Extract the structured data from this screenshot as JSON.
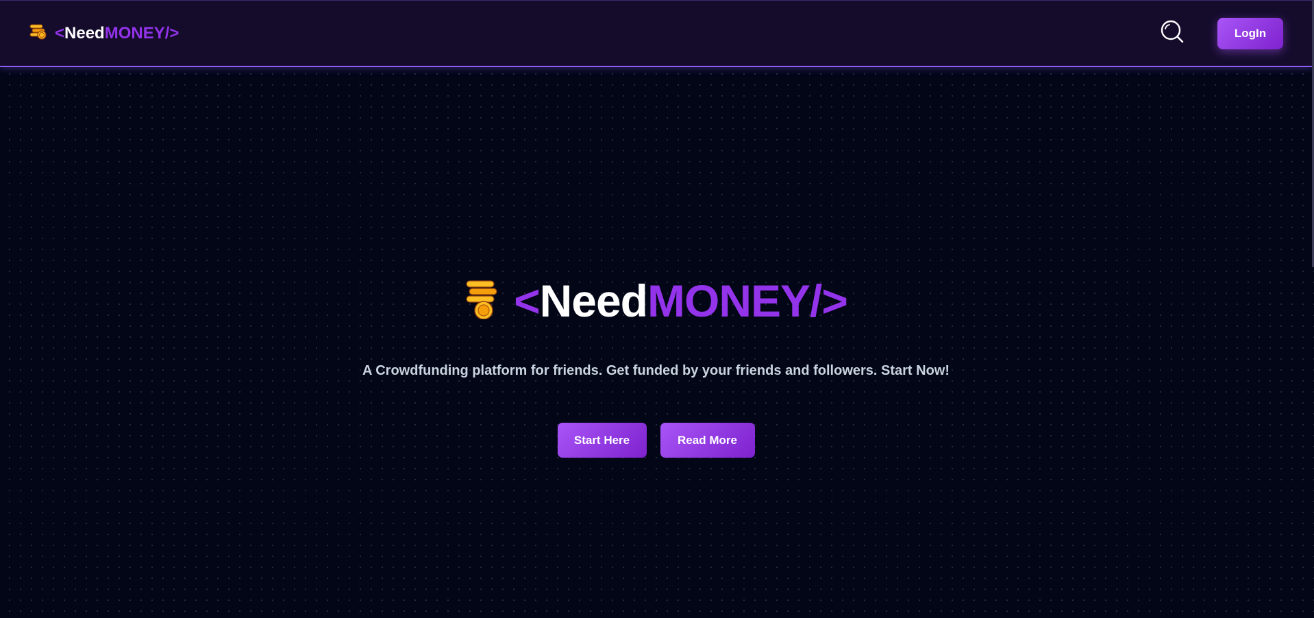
{
  "brand": {
    "bracket_open": "<",
    "need": "Need",
    "money": "MONEY",
    "bracket_close": "/>",
    "icon": "coin-stack-icon"
  },
  "navbar": {
    "search_icon": "search-icon",
    "login_label": "LogIn"
  },
  "hero": {
    "title": {
      "bracket_open": "<",
      "need": "Need",
      "money": "MONEY",
      "bracket_close": "/>"
    },
    "tagline": "A Crowdfunding platform for friends. Get funded by your friends and followers. Start Now!",
    "buttons": {
      "start": "Start Here",
      "read": "Read More"
    }
  },
  "colors": {
    "background": "#020617",
    "navbar": "#150c2c",
    "accent": "#9333ea",
    "button": "#a855f7",
    "coin": "#fbbf24"
  }
}
